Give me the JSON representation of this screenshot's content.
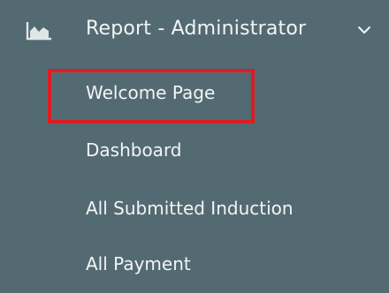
{
  "menu": {
    "section_label": "Report - Administrator",
    "section_icon": "area-chart-icon",
    "expand_icon": "chevron-down-icon",
    "items": [
      {
        "label": "Welcome Page",
        "highlighted": true
      },
      {
        "label": "Dashboard"
      },
      {
        "label": "All Submitted Induction"
      },
      {
        "label": "All Payment"
      }
    ]
  },
  "colors": {
    "background": "#546a72",
    "text": "#f2f5f6",
    "highlight_border": "#e01b22"
  }
}
